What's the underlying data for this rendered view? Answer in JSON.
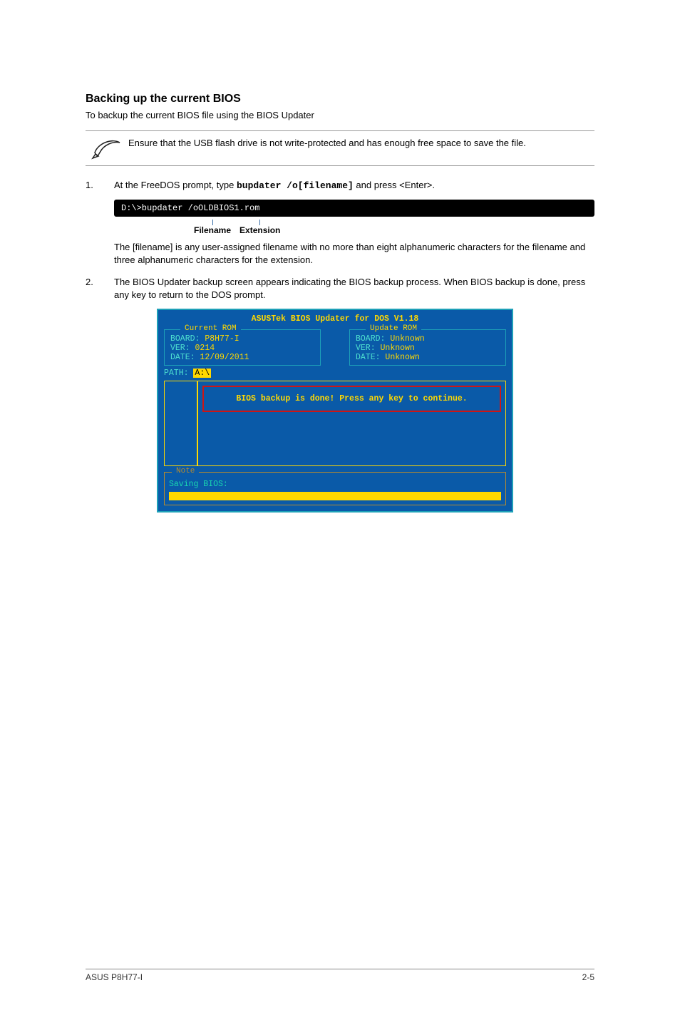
{
  "section": {
    "title": "Backing up the current BIOS",
    "lead": "To backup the current BIOS file using the BIOS Updater"
  },
  "note": {
    "text": "Ensure that the USB flash drive is not write-protected and has enough free space to save the file."
  },
  "step1": {
    "num": "1.",
    "text_a": "At the FreeDOS prompt, type ",
    "cmd": "bupdater /o[filename]",
    "text_b": " and press <Enter>.",
    "code": "D:\\>bupdater /oOLDBIOS1.rom",
    "filename_label": "Filename",
    "ext_label": "Extension",
    "sub": "The [filename] is any user-assigned filename with no more than eight alphanumeric characters for the filename and three alphanumeric characters for the extension."
  },
  "step2": {
    "num": "2.",
    "text": "The BIOS Updater backup screen appears indicating the BIOS backup process. When BIOS backup is done, press any key to return to the DOS prompt."
  },
  "bios": {
    "title": "ASUSTek BIOS Updater for DOS V1.18",
    "current_legend": "Current ROM",
    "update_legend": "Update ROM",
    "cur_board_l": "BOARD: ",
    "cur_board_v": "P8H77-I",
    "cur_ver_l": "VER: ",
    "cur_ver_v": "0214",
    "cur_date_l": "DATE: ",
    "cur_date_v": "12/09/2011",
    "upd_board_l": "BOARD: ",
    "upd_board_v": "Unknown",
    "upd_ver_l": "VER: ",
    "upd_ver_v": "Unknown",
    "upd_date_l": "DATE: ",
    "upd_date_v": "Unknown",
    "path_l": "PATH: ",
    "path_v": "A:\\",
    "msg": "BIOS backup is done! Press any key to continue.",
    "note_legend": "Note",
    "saving": "Saving BIOS:"
  },
  "footer": {
    "left": "ASUS P8H77-I",
    "right": "2-5"
  }
}
